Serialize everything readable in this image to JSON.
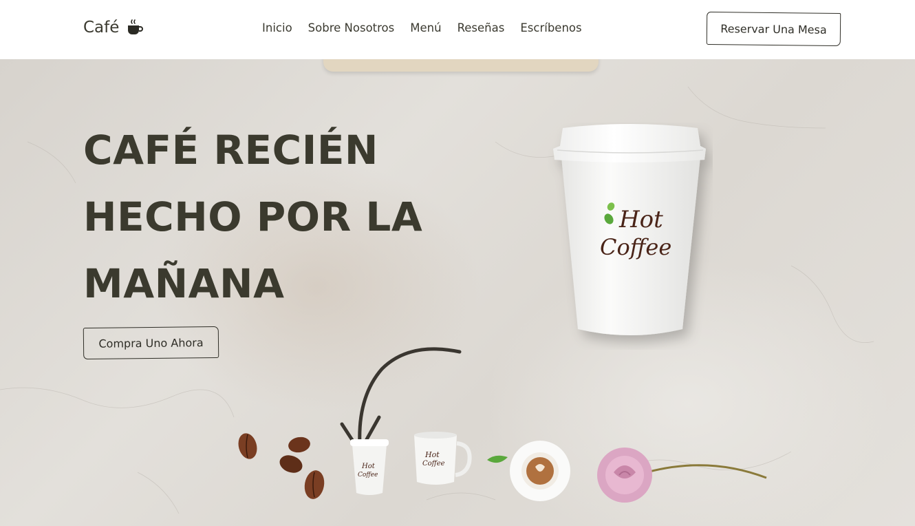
{
  "header": {
    "logo_text": "Café",
    "logo_icon": "coffee-cup-icon",
    "nav": [
      "Inicio",
      "Sobre Nosotros",
      "Menú",
      "Reseñas",
      "Escríbenos"
    ],
    "reserve_label": "Reservar Una Mesa"
  },
  "hero": {
    "title_lines": [
      "CAFÉ RECIÉN",
      "HECHO POR LA",
      "MAÑANA"
    ],
    "cta_label": "Compra Uno Ahora",
    "cup_brand_top": "Hot",
    "cup_brand_bottom": "Coffee"
  },
  "colors": {
    "text": "#3b3a2e",
    "header_bg": "#ffffff",
    "hero_bg": "#dcd8d2",
    "brand_brown": "#4a2418",
    "brand_green": "#5aa83c"
  }
}
